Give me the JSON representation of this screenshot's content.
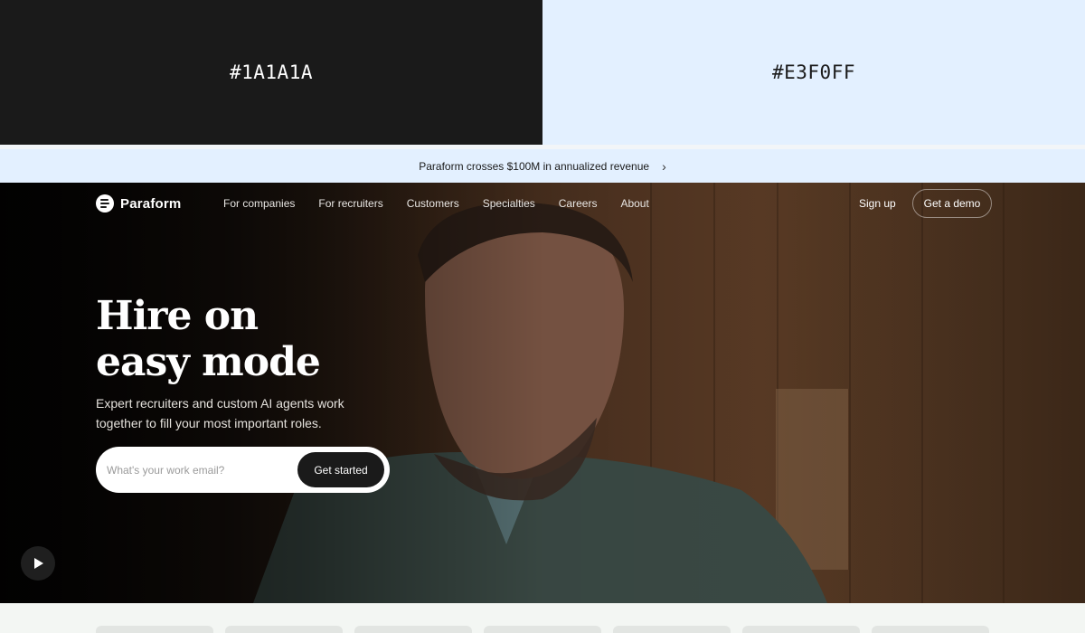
{
  "swatches": [
    {
      "label": "#1A1A1A",
      "color": "#1A1A1A"
    },
    {
      "label": "#E3F0FF",
      "color": "#E3F0FF"
    }
  ],
  "announcement": {
    "text": "Paraform crosses $100M in annualized revenue",
    "icon": "chevron-right-icon"
  },
  "brand": {
    "name": "Paraform",
    "icon": "paraform-logo-icon"
  },
  "nav": [
    "For companies",
    "For recruiters",
    "Customers",
    "Specialties",
    "Careers",
    "About"
  ],
  "header_actions": {
    "signup": "Sign up",
    "demo": "Get a demo"
  },
  "hero": {
    "headline_line1": "Hire on",
    "headline_line2": "easy mode",
    "subtitle": "Expert recruiters and custom AI agents work together to fill your most important roles.",
    "email_placeholder": "What's your work email?",
    "cta": "Get started",
    "play_icon": "play-icon"
  },
  "colors": {
    "dark": "#1A1A1A",
    "accent": "#E3F0FF",
    "white": "#FFFFFF"
  }
}
